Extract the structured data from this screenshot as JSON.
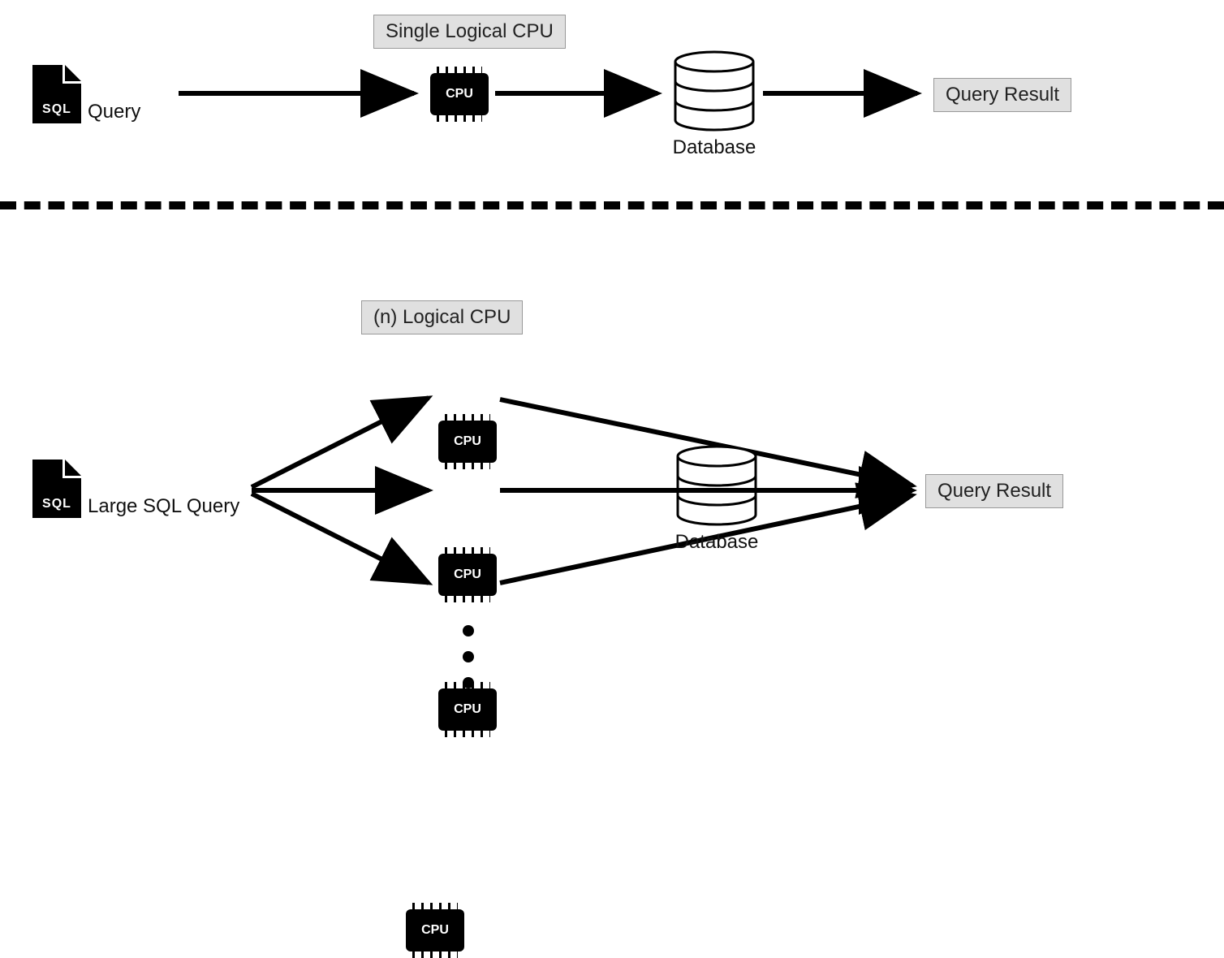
{
  "top": {
    "sql_icon_text": "SQL",
    "query_label": "Query",
    "cpu_header": "Single Logical CPU",
    "cpu_label": "CPU",
    "db_label": "Database",
    "result_box": "Query Result"
  },
  "bottom": {
    "sql_icon_text": "SQL",
    "query_label": "Large SQL Query",
    "cpu_header": "(n) Logical CPU",
    "cpu_label": "CPU",
    "db_label": "Database",
    "result_box": "Query Result"
  }
}
